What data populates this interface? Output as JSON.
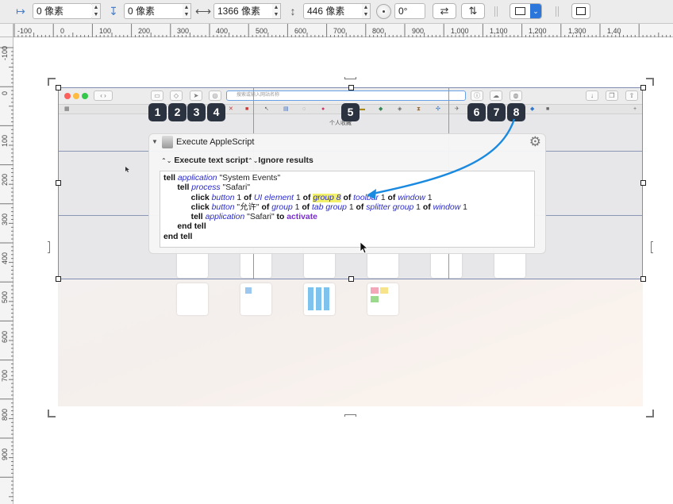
{
  "toolbar": {
    "x_value": "0 像素",
    "y_value": "0 像素",
    "width_value": "1366 像素",
    "height_value": "446 像素",
    "rotation_value": "0°",
    "flip_horizontal_icon": "⇄",
    "flip_vertical_icon": "⇅"
  },
  "ruler": {
    "horizontal": [
      "-100",
      "0",
      "100",
      "200",
      "300",
      "400",
      "500",
      "600",
      "700",
      "800",
      "900",
      "1,000",
      "1,100",
      "1,200",
      "1,300",
      "1,40"
    ],
    "vertical": [
      "-100",
      "0",
      "100",
      "200",
      "300",
      "400",
      "500",
      "600",
      "700",
      "800",
      "900"
    ]
  },
  "safari": {
    "address_placeholder": "搜索或输入网站名称",
    "favorites_title": "个人收藏"
  },
  "callouts": [
    "1",
    "2",
    "3",
    "4",
    "5",
    "6",
    "7",
    "8"
  ],
  "action": {
    "title": "Execute AppleScript",
    "mode_label": "Execute text script",
    "ignore_label": "Ignore results"
  },
  "script": {
    "l1_a": "tell ",
    "l1_b": "application",
    "l1_c": " \"System Events\"",
    "l2_a": "tell ",
    "l2_b": "process",
    "l2_c": " \"Safari\"",
    "l3_a": "click ",
    "l3_b": "button",
    "l3_c": " 1 ",
    "l3_d": "of ",
    "l3_e": "UI element",
    "l3_f": " 1 ",
    "l3_g": "of ",
    "l3_h": "group 8",
    "l3_i": " ",
    "l3_j": "of ",
    "l3_k": "toolbar",
    "l3_l": " 1 ",
    "l3_m": "of ",
    "l3_n": "window",
    "l3_o": " 1",
    "l4_a": "click ",
    "l4_b": "button",
    "l4_c": " \"允许\" ",
    "l4_d": "of ",
    "l4_e": "group",
    "l4_f": " 1 ",
    "l4_g": "of ",
    "l4_h": "tab group",
    "l4_i": " 1 ",
    "l4_j": "of ",
    "l4_k": "splitter group",
    "l4_l": " 1 ",
    "l4_m": "of ",
    "l4_n": "window",
    "l4_o": " 1",
    "l5_a": "tell ",
    "l5_b": "application",
    "l5_c": " \"Safari\" ",
    "l5_d": "to ",
    "l5_e": "activate",
    "l6": "end tell",
    "l7": "end tell"
  },
  "colors": {
    "callout_bg": "#2b3340",
    "arrow": "#1a8ae0",
    "highlight": "#f3f06a",
    "keyword_class": "#2a2ac8",
    "keyword_activate": "#7a2ed0"
  }
}
